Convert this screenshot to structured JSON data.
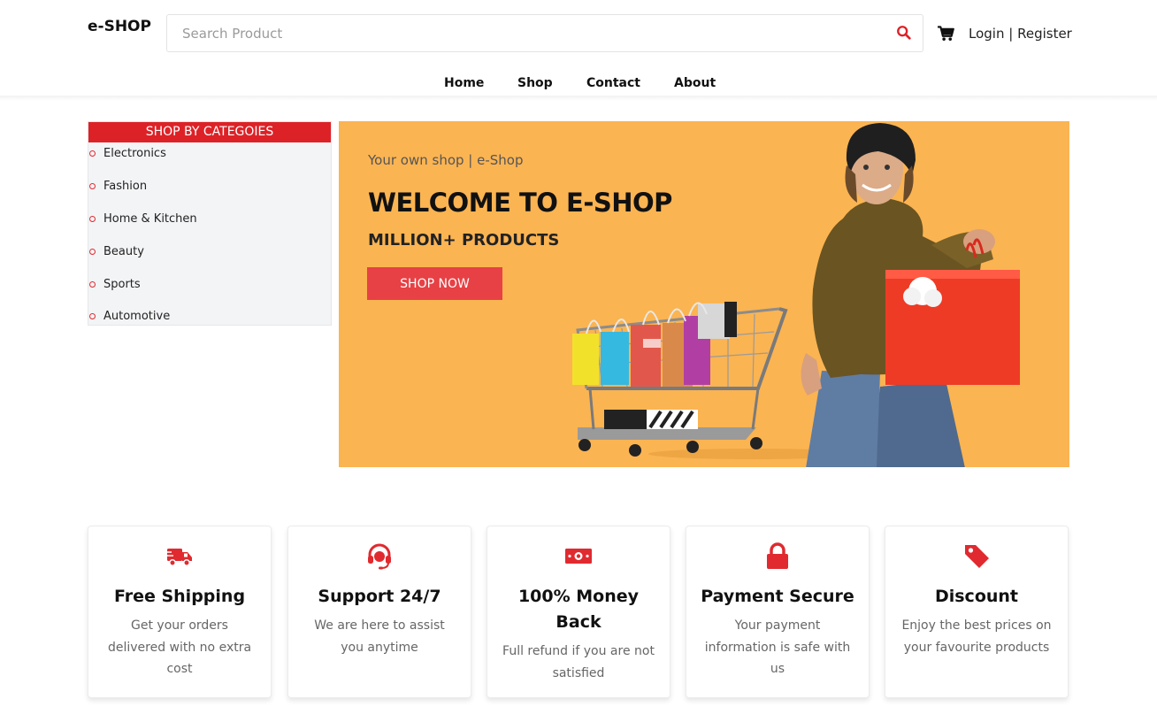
{
  "header": {
    "logo": "e-SHOP",
    "search_placeholder": "Search Product",
    "search_icon": "search-icon",
    "cart_icon": "cart-icon",
    "login_label": "Login",
    "separator": "|",
    "register_label": "Register"
  },
  "nav": {
    "items": [
      {
        "label": "Home"
      },
      {
        "label": "Shop"
      },
      {
        "label": "Contact"
      },
      {
        "label": "About"
      }
    ]
  },
  "categories": {
    "title": "SHOP BY CATEGOIES",
    "items": [
      {
        "label": "Electronics"
      },
      {
        "label": "Fashion"
      },
      {
        "label": "Home & Kitchen"
      },
      {
        "label": "Beauty"
      },
      {
        "label": "Sports"
      },
      {
        "label": "Automotive"
      }
    ]
  },
  "hero": {
    "tagline": "Your own shop | e-Shop",
    "title": "WELCOME TO E-SHOP",
    "subtitle": "MILLION+ PRODUCTS",
    "button_label": "SHOP NOW",
    "background_color": "#fbb452",
    "button_color": "#e74145"
  },
  "features": [
    {
      "icon": "truck-icon",
      "title": "Free Shipping",
      "description": "Get your orders delivered with no extra cost"
    },
    {
      "icon": "headset-icon",
      "title": "Support 24/7",
      "description": "We are here to assist you anytime"
    },
    {
      "icon": "money-icon",
      "title": "100% Money Back",
      "description": "Full refund if you are not satisfied"
    },
    {
      "icon": "lock-icon",
      "title": "Payment Secure",
      "description": "Your payment information is safe with us"
    },
    {
      "icon": "tag-icon",
      "title": "Discount",
      "description": "Enjoy the best prices on your favourite products"
    }
  ],
  "colors": {
    "accent": "#dd2227",
    "sidebar_bg": "#f3f4f6"
  }
}
